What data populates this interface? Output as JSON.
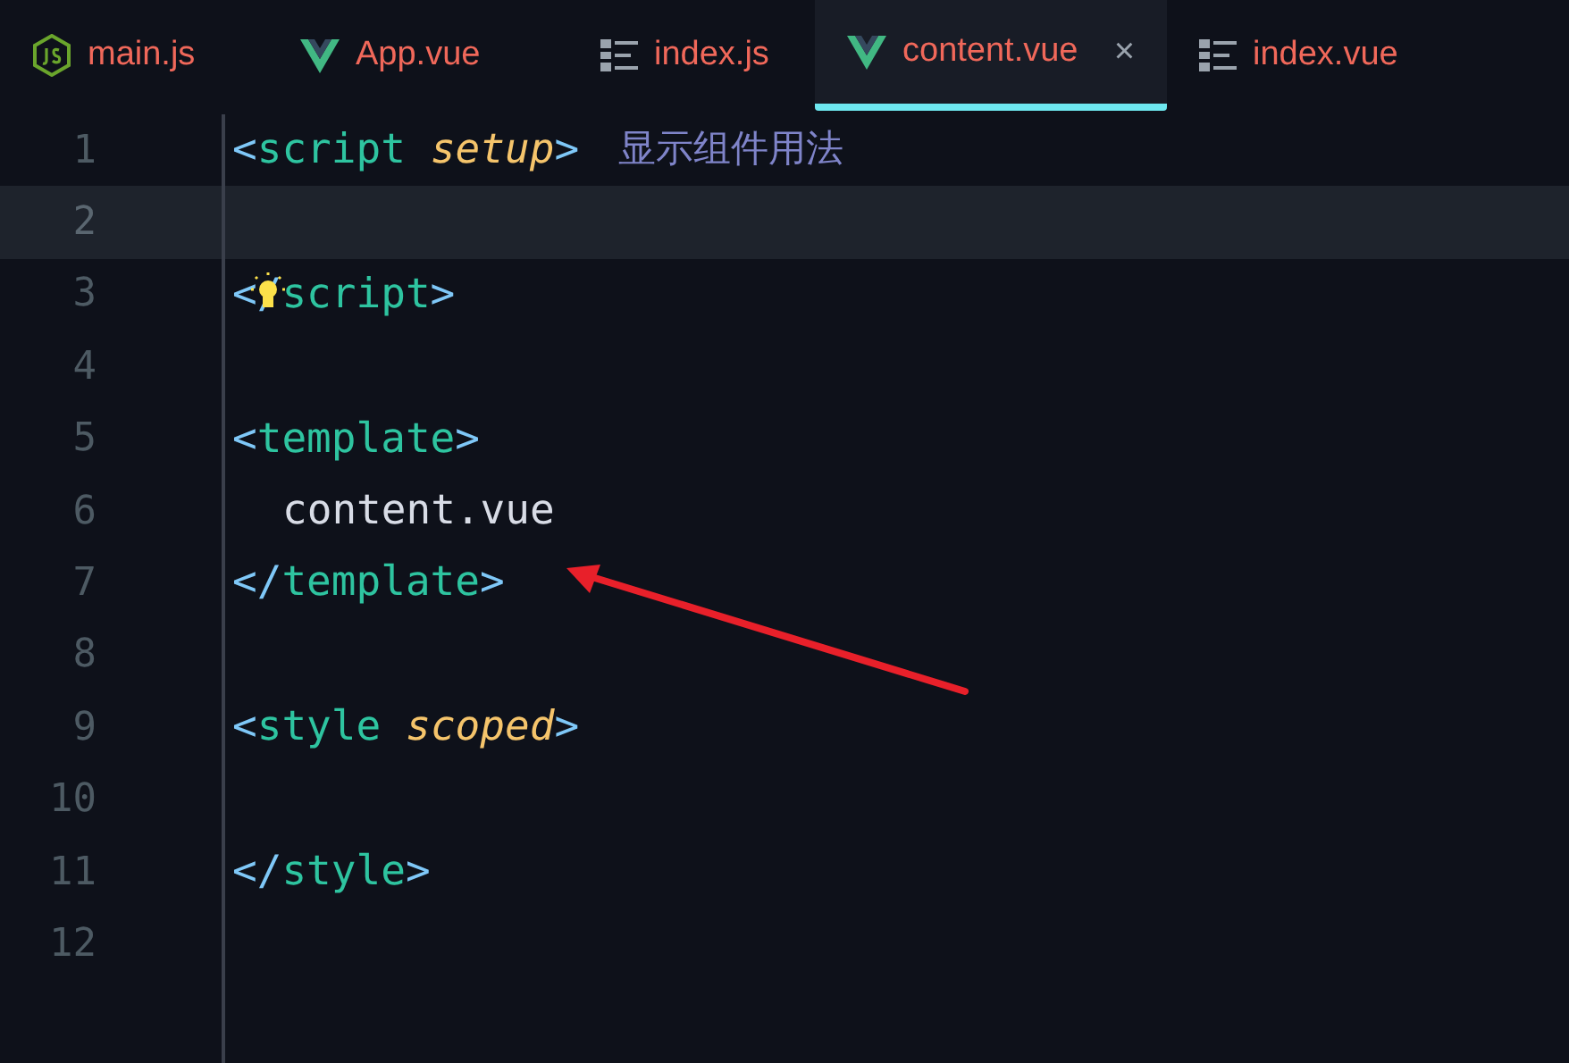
{
  "tabs": [
    {
      "label": "main.js",
      "kind": "node",
      "selected": false
    },
    {
      "label": "App.vue",
      "kind": "vue",
      "selected": false
    },
    {
      "label": "index.js",
      "kind": "list",
      "selected": false
    },
    {
      "label": "content.vue",
      "kind": "vue",
      "selected": true,
      "close": "×"
    },
    {
      "label": "index.vue",
      "kind": "list",
      "selected": false
    }
  ],
  "editor": {
    "lines": [
      {
        "number": "1",
        "current": false,
        "tokens": [
          {
            "kind": "bracket",
            "text": "<"
          },
          {
            "kind": "tag",
            "text": "script"
          },
          {
            "kind": "attr",
            "text": "setup"
          },
          {
            "kind": "bracket",
            "text": ">"
          },
          {
            "kind": "hint",
            "text": "显示组件用法"
          }
        ]
      },
      {
        "number": "2",
        "current": true
      },
      {
        "number": "3",
        "current": false,
        "bulb": true,
        "tokens": [
          {
            "kind": "bracket",
            "text": "</"
          },
          {
            "kind": "tag",
            "text": "script"
          },
          {
            "kind": "bracket",
            "text": ">"
          }
        ]
      },
      {
        "number": "4",
        "current": false
      },
      {
        "number": "5",
        "current": false,
        "tokens": [
          {
            "kind": "bracket",
            "text": "<"
          },
          {
            "kind": "tag",
            "text": "template"
          },
          {
            "kind": "bracket",
            "text": ">"
          }
        ]
      },
      {
        "number": "6",
        "current": false,
        "tokens": [
          {
            "kind": "plain",
            "text": "content.vue"
          }
        ]
      },
      {
        "number": "7",
        "current": false,
        "tokens": [
          {
            "kind": "bracket",
            "text": "</"
          },
          {
            "kind": "tag",
            "text": "template"
          },
          {
            "kind": "bracket",
            "text": ">"
          }
        ]
      },
      {
        "number": "8",
        "current": false
      },
      {
        "number": "9",
        "current": false,
        "tokens": [
          {
            "kind": "bracket",
            "text": "<"
          },
          {
            "kind": "tag",
            "text": "style"
          },
          {
            "kind": "attr",
            "text": "scoped"
          },
          {
            "kind": "bracket",
            "text": ">"
          }
        ]
      },
      {
        "number": "10",
        "current": false
      },
      {
        "number": "11",
        "current": false,
        "tokens": [
          {
            "kind": "bracket",
            "text": "</"
          },
          {
            "kind": "tag",
            "text": "style"
          },
          {
            "kind": "bracket",
            "text": ">"
          }
        ]
      },
      {
        "number": "12",
        "current": false
      }
    ]
  }
}
